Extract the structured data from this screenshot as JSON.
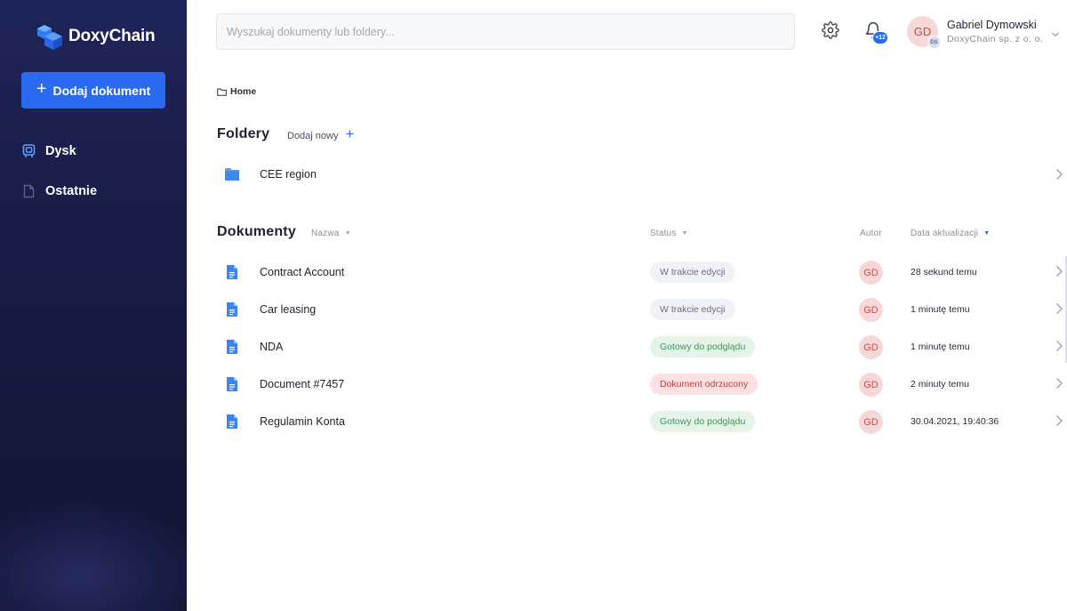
{
  "app": {
    "name": "DoxyChain",
    "colors": {
      "sidebar": "#1a1e4a",
      "accent": "#2a6af0",
      "ready": "#3a9b58",
      "rejected": "#c23d3d"
    }
  },
  "sidebar": {
    "add_button_label": "Dodaj dokument",
    "items": [
      {
        "label": "Dysk",
        "icon": "drive-icon",
        "active": true
      },
      {
        "label": "Ostatnie",
        "icon": "file-icon",
        "active": false
      }
    ]
  },
  "header": {
    "search_placeholder": "Wyszukaj dokumenty lub foldery...",
    "notifications_badge": "+12",
    "user": {
      "initials": "GD",
      "org_initials": "DS",
      "name": "Gabriel Dymowski",
      "org": "DoxyChain sp. z o. o."
    }
  },
  "breadcrumb": {
    "label": "Home"
  },
  "folders": {
    "title": "Foldery",
    "add_new_label": "Dodaj nowy",
    "items": [
      {
        "name": "CEE region"
      }
    ]
  },
  "documents": {
    "title": "Dokumenty",
    "columns": {
      "name": "Nazwa",
      "status": "Status",
      "author": "Autor",
      "updated": "Data aktualizacji"
    },
    "rows": [
      {
        "name": "Contract Account",
        "status": "W trakcie edycji",
        "status_type": "edit",
        "author": "GD",
        "updated": "28 sekund temu"
      },
      {
        "name": "Car leasing",
        "status": "W trakcie edycji",
        "status_type": "edit",
        "author": "GD",
        "updated": "1 minutę temu"
      },
      {
        "name": "NDA",
        "status": "Gotowy do podglądu",
        "status_type": "ready",
        "author": "GD",
        "updated": "1 minutę temu"
      },
      {
        "name": "Document #7457",
        "status": "Dokument odrzucony",
        "status_type": "rejected",
        "author": "GD",
        "updated": "2 minuty temu"
      },
      {
        "name": "Regulamin Konta",
        "status": "Gotowy do podglądu",
        "status_type": "ready",
        "author": "GD",
        "updated": "30.04.2021, 19:40:36"
      }
    ]
  }
}
